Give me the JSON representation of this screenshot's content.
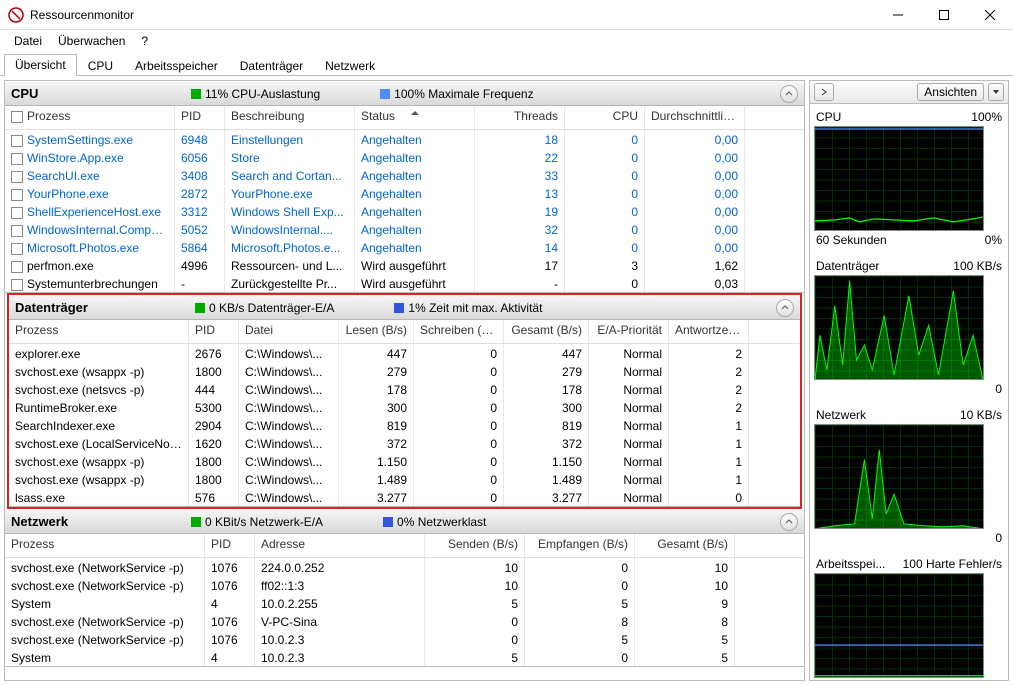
{
  "window": {
    "title": "Ressourcenmonitor"
  },
  "menu": [
    "Datei",
    "Überwachen",
    "?"
  ],
  "tabs": [
    "Übersicht",
    "CPU",
    "Arbeitsspeicher",
    "Datenträger",
    "Netzwerk"
  ],
  "activeTab": 0,
  "views": {
    "button": "Ansichten"
  },
  "cpu": {
    "title": "CPU",
    "stat1": "11% CPU-Auslastung",
    "stat2": "100% Maximale Frequenz",
    "cols": [
      "Prozess",
      "PID",
      "Beschreibung",
      "Status",
      "Threads",
      "CPU",
      "Durchschnittlic..."
    ],
    "rows": [
      {
        "p": "SystemSettings.exe",
        "pid": "6948",
        "d": "Einstellungen",
        "s": "Angehalten",
        "t": "18",
        "c": "0",
        "a": "0,00",
        "sus": true
      },
      {
        "p": "WinStore.App.exe",
        "pid": "6056",
        "d": "Store",
        "s": "Angehalten",
        "t": "22",
        "c": "0",
        "a": "0,00",
        "sus": true
      },
      {
        "p": "SearchUI.exe",
        "pid": "3408",
        "d": "Search and Cortan...",
        "s": "Angehalten",
        "t": "33",
        "c": "0",
        "a": "0,00",
        "sus": true
      },
      {
        "p": "YourPhone.exe",
        "pid": "2872",
        "d": "YourPhone.exe",
        "s": "Angehalten",
        "t": "13",
        "c": "0",
        "a": "0,00",
        "sus": true
      },
      {
        "p": "ShellExperienceHost.exe",
        "pid": "3312",
        "d": "Windows Shell Exp...",
        "s": "Angehalten",
        "t": "19",
        "c": "0",
        "a": "0,00",
        "sus": true
      },
      {
        "p": "WindowsInternal.Composa...",
        "pid": "5052",
        "d": "WindowsInternal....",
        "s": "Angehalten",
        "t": "32",
        "c": "0",
        "a": "0,00",
        "sus": true
      },
      {
        "p": "Microsoft.Photos.exe",
        "pid": "5864",
        "d": "Microsoft.Photos.e...",
        "s": "Angehalten",
        "t": "14",
        "c": "0",
        "a": "0,00",
        "sus": true
      },
      {
        "p": "perfmon.exe",
        "pid": "4996",
        "d": "Ressourcen- und L...",
        "s": "Wird ausgeführt",
        "t": "17",
        "c": "3",
        "a": "1,62",
        "sus": false
      },
      {
        "p": "Systemunterbrechungen",
        "pid": "-",
        "d": "Zurückgestellte Pr...",
        "s": "Wird ausgeführt",
        "t": "-",
        "c": "0",
        "a": "0,03",
        "sus": false
      }
    ]
  },
  "disk": {
    "title": "Datenträger",
    "stat1": "0 KB/s Datenträger-E/A",
    "stat2": "1% Zeit mit max. Aktivität",
    "cols": [
      "Prozess",
      "PID",
      "Datei",
      "Lesen (B/s)",
      "Schreiben (B...",
      "Gesamt (B/s)",
      "E/A-Priorität",
      "Antwortzeit ..."
    ],
    "rows": [
      {
        "p": "explorer.exe",
        "pid": "2676",
        "f": "C:\\Windows\\...",
        "r": "447",
        "w": "0",
        "g": "447",
        "pr": "Normal",
        "a": "2"
      },
      {
        "p": "svchost.exe (wsappx -p)",
        "pid": "1800",
        "f": "C:\\Windows\\...",
        "r": "279",
        "w": "0",
        "g": "279",
        "pr": "Normal",
        "a": "2"
      },
      {
        "p": "svchost.exe (netsvcs -p)",
        "pid": "444",
        "f": "C:\\Windows\\...",
        "r": "178",
        "w": "0",
        "g": "178",
        "pr": "Normal",
        "a": "2"
      },
      {
        "p": "RuntimeBroker.exe",
        "pid": "5300",
        "f": "C:\\Windows\\...",
        "r": "300",
        "w": "0",
        "g": "300",
        "pr": "Normal",
        "a": "2"
      },
      {
        "p": "SearchIndexer.exe",
        "pid": "2904",
        "f": "C:\\Windows\\...",
        "r": "819",
        "w": "0",
        "g": "819",
        "pr": "Normal",
        "a": "1"
      },
      {
        "p": "svchost.exe (LocalServiceNoNet...",
        "pid": "1620",
        "f": "C:\\Windows\\...",
        "r": "372",
        "w": "0",
        "g": "372",
        "pr": "Normal",
        "a": "1"
      },
      {
        "p": "svchost.exe (wsappx -p)",
        "pid": "1800",
        "f": "C:\\Windows\\...",
        "r": "1.150",
        "w": "0",
        "g": "1.150",
        "pr": "Normal",
        "a": "1"
      },
      {
        "p": "svchost.exe (wsappx -p)",
        "pid": "1800",
        "f": "C:\\Windows\\...",
        "r": "1.489",
        "w": "0",
        "g": "1.489",
        "pr": "Normal",
        "a": "1"
      },
      {
        "p": "lsass.exe",
        "pid": "576",
        "f": "C:\\Windows\\...",
        "r": "3.277",
        "w": "0",
        "g": "3.277",
        "pr": "Normal",
        "a": "0"
      }
    ]
  },
  "net": {
    "title": "Netzwerk",
    "stat1": "0 KBit/s Netzwerk-E/A",
    "stat2": "0% Netzwerklast",
    "cols": [
      "Prozess",
      "PID",
      "Adresse",
      "Senden (B/s)",
      "Empfangen (B/s)",
      "Gesamt (B/s)"
    ],
    "rows": [
      {
        "p": "svchost.exe (NetworkService -p)",
        "pid": "1076",
        "a": "224.0.0.252",
        "s": "10",
        "e": "0",
        "g": "10"
      },
      {
        "p": "svchost.exe (NetworkService -p)",
        "pid": "1076",
        "a": "ff02::1:3",
        "s": "10",
        "e": "0",
        "g": "10"
      },
      {
        "p": "System",
        "pid": "4",
        "a": "10.0.2.255",
        "s": "5",
        "e": "5",
        "g": "9"
      },
      {
        "p": "svchost.exe (NetworkService -p)",
        "pid": "1076",
        "a": "V-PC-Sina",
        "s": "0",
        "e": "8",
        "g": "8"
      },
      {
        "p": "svchost.exe (NetworkService -p)",
        "pid": "1076",
        "a": "10.0.2.3",
        "s": "0",
        "e": "5",
        "g": "5"
      },
      {
        "p": "System",
        "pid": "4",
        "a": "10.0.2.3",
        "s": "5",
        "e": "0",
        "g": "5"
      }
    ]
  },
  "graphs": {
    "cpu": {
      "t": "CPU",
      "r": "100%",
      "bl": "60 Sekunden",
      "br": "0%"
    },
    "disk": {
      "t": "Datenträger",
      "r": "100 KB/s",
      "br": "0"
    },
    "net": {
      "t": "Netzwerk",
      "r": "10 KB/s",
      "br": "0"
    },
    "mem": {
      "t": "Arbeitsspei...",
      "r": "100 Harte Fehler/s"
    }
  }
}
